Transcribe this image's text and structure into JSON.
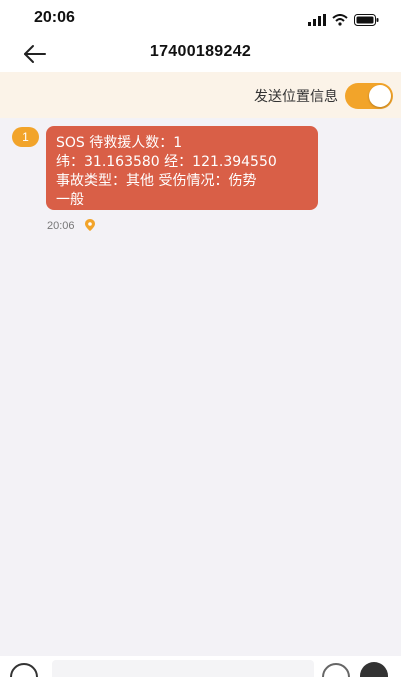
{
  "status_bar": {
    "time": "20:06",
    "icons": [
      "signal-icon",
      "wifi-icon",
      "battery-icon"
    ]
  },
  "nav": {
    "title": "17400189242",
    "back_icon": "arrow-left-icon"
  },
  "location": {
    "label": "发送位置信息",
    "toggle_on": true
  },
  "message": {
    "index": "1",
    "lines": [
      "SOS 待救援人数：1",
      " 纬：31.163580 经：121.394550",
      " 事故类型：其他 受伤情况：伤势",
      "一般"
    ],
    "time": "20:06",
    "location_icon": "location-pin-icon"
  },
  "input_bar": {
    "voice_icon": "voice-icon",
    "emoji_icon": "emoji-icon",
    "extra_icon": "pen-icon",
    "placeholder": ""
  },
  "colors": {
    "accent": "#f2a42a",
    "bubble": "#d95f47",
    "background": "#f3f2f6",
    "location_bar": "#fbf3e8"
  }
}
